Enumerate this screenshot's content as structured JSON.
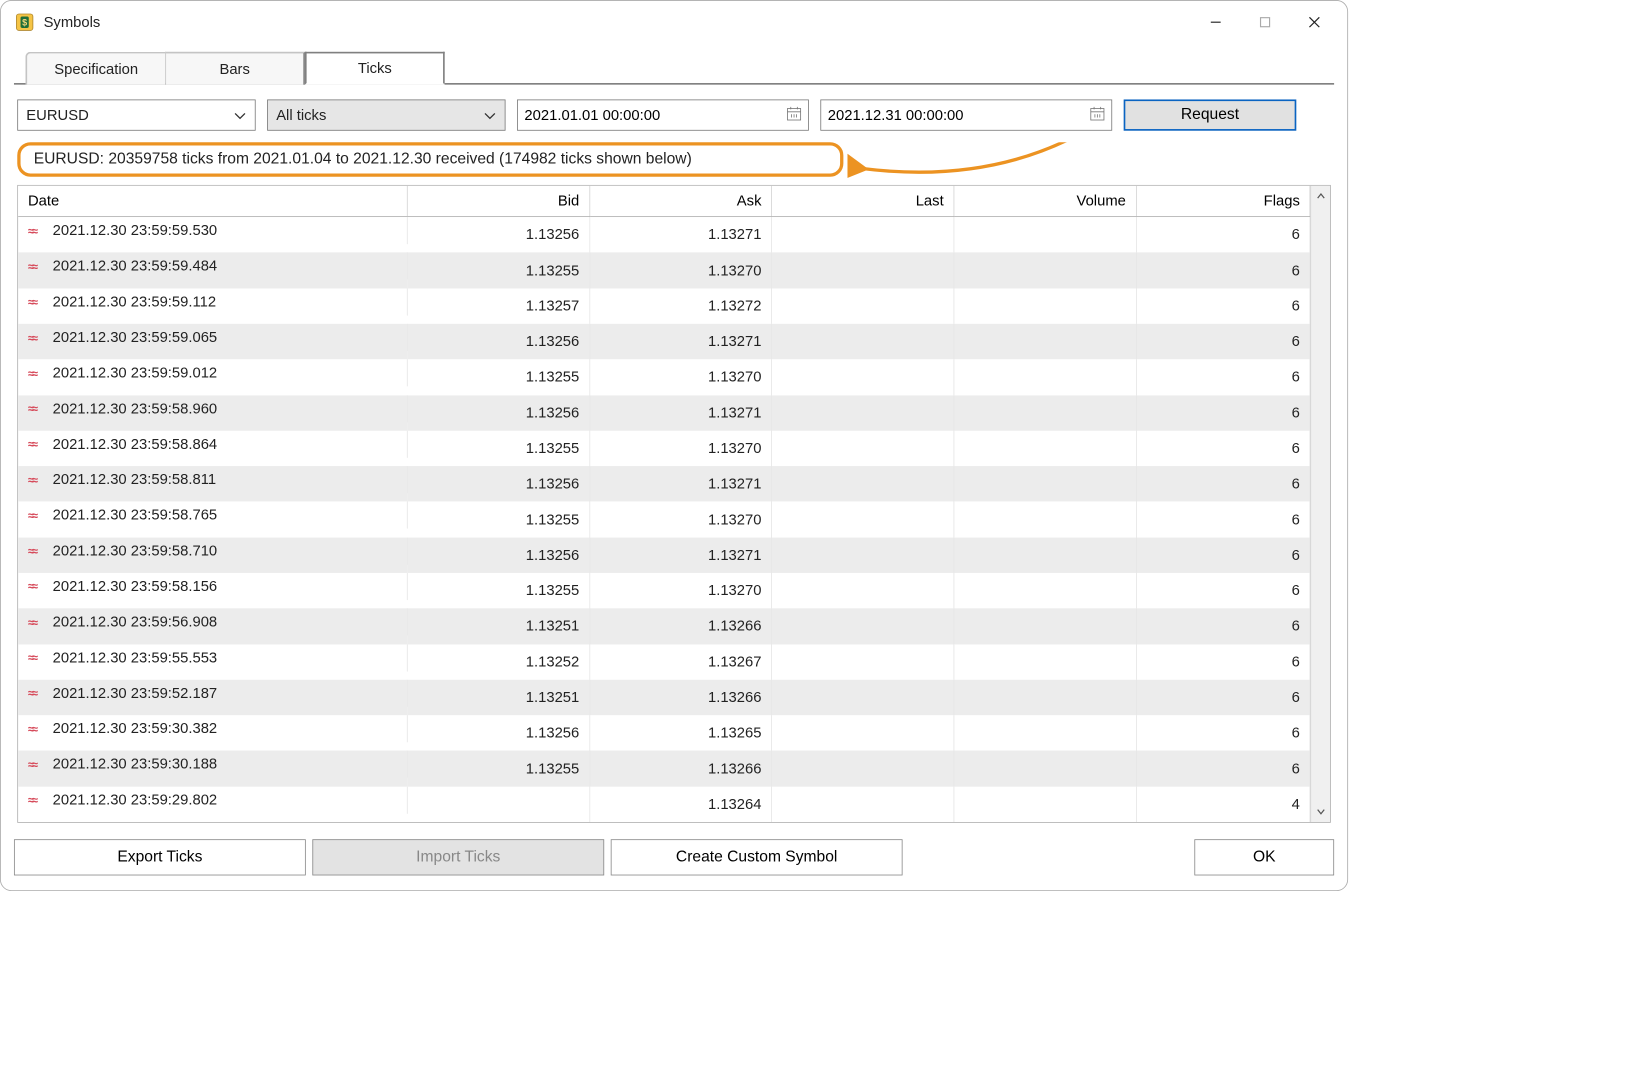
{
  "window": {
    "title": "Symbols"
  },
  "tabs": {
    "t0": "Specification",
    "t1": "Bars",
    "t2": "Ticks"
  },
  "controls": {
    "symbol": "EURUSD",
    "mode": "All ticks",
    "from": "2021.01.01 00:00:00",
    "to": "2021.12.31 00:00:00",
    "request": "Request"
  },
  "status": "EURUSD: 20359758 ticks from 2021.01.04 to 2021.12.30 received (174982 ticks shown below)",
  "columns": {
    "date": "Date",
    "bid": "Bid",
    "ask": "Ask",
    "last": "Last",
    "volume": "Volume",
    "flags": "Flags"
  },
  "rows": [
    {
      "date": "2021.12.30 23:59:59.530",
      "bid": "1.13256",
      "ask": "1.13271",
      "last": "",
      "vol": "",
      "flags": "6"
    },
    {
      "date": "2021.12.30 23:59:59.484",
      "bid": "1.13255",
      "ask": "1.13270",
      "last": "",
      "vol": "",
      "flags": "6"
    },
    {
      "date": "2021.12.30 23:59:59.112",
      "bid": "1.13257",
      "ask": "1.13272",
      "last": "",
      "vol": "",
      "flags": "6"
    },
    {
      "date": "2021.12.30 23:59:59.065",
      "bid": "1.13256",
      "ask": "1.13271",
      "last": "",
      "vol": "",
      "flags": "6"
    },
    {
      "date": "2021.12.30 23:59:59.012",
      "bid": "1.13255",
      "ask": "1.13270",
      "last": "",
      "vol": "",
      "flags": "6"
    },
    {
      "date": "2021.12.30 23:59:58.960",
      "bid": "1.13256",
      "ask": "1.13271",
      "last": "",
      "vol": "",
      "flags": "6"
    },
    {
      "date": "2021.12.30 23:59:58.864",
      "bid": "1.13255",
      "ask": "1.13270",
      "last": "",
      "vol": "",
      "flags": "6"
    },
    {
      "date": "2021.12.30 23:59:58.811",
      "bid": "1.13256",
      "ask": "1.13271",
      "last": "",
      "vol": "",
      "flags": "6"
    },
    {
      "date": "2021.12.30 23:59:58.765",
      "bid": "1.13255",
      "ask": "1.13270",
      "last": "",
      "vol": "",
      "flags": "6"
    },
    {
      "date": "2021.12.30 23:59:58.710",
      "bid": "1.13256",
      "ask": "1.13271",
      "last": "",
      "vol": "",
      "flags": "6"
    },
    {
      "date": "2021.12.30 23:59:58.156",
      "bid": "1.13255",
      "ask": "1.13270",
      "last": "",
      "vol": "",
      "flags": "6"
    },
    {
      "date": "2021.12.30 23:59:56.908",
      "bid": "1.13251",
      "ask": "1.13266",
      "last": "",
      "vol": "",
      "flags": "6"
    },
    {
      "date": "2021.12.30 23:59:55.553",
      "bid": "1.13252",
      "ask": "1.13267",
      "last": "",
      "vol": "",
      "flags": "6"
    },
    {
      "date": "2021.12.30 23:59:52.187",
      "bid": "1.13251",
      "ask": "1.13266",
      "last": "",
      "vol": "",
      "flags": "6"
    },
    {
      "date": "2021.12.30 23:59:30.382",
      "bid": "1.13256",
      "ask": "1.13265",
      "last": "",
      "vol": "",
      "flags": "6"
    },
    {
      "date": "2021.12.30 23:59:30.188",
      "bid": "1.13255",
      "ask": "1.13266",
      "last": "",
      "vol": "",
      "flags": "6"
    },
    {
      "date": "2021.12.30 23:59:29.802",
      "bid": "",
      "ask": "1.13264",
      "last": "",
      "vol": "",
      "flags": "4"
    }
  ],
  "footer": {
    "export": "Export Ticks",
    "import": "Import Ticks",
    "custom": "Create Custom Symbol",
    "ok": "OK"
  }
}
